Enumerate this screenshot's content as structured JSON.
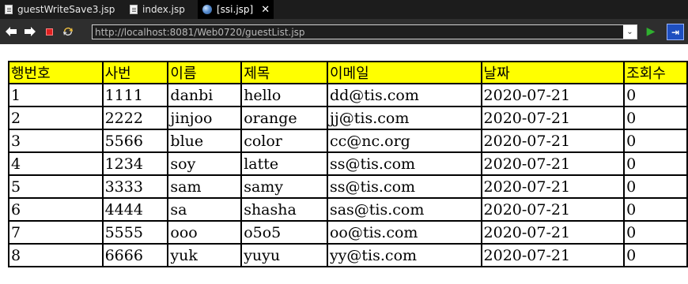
{
  "tabs": [
    {
      "label": "guestWriteSave3.jsp",
      "icon": "file-icon",
      "active": false
    },
    {
      "label": "index.jsp",
      "icon": "file-icon",
      "active": false
    },
    {
      "label": "[ssi.jsp]",
      "icon": "globe-icon",
      "active": true,
      "close": "✕"
    }
  ],
  "toolbar": {
    "back": "back-arrow-icon",
    "forward": "forward-arrow-icon",
    "stop": "stop-icon",
    "refresh": "refresh-icon",
    "url": "http://localhost:8081/Web0720/guestList.jsp",
    "dropdown": "⌄",
    "go": "go-icon",
    "external": "external-browser-icon"
  },
  "table": {
    "headers": [
      "행번호",
      "사번",
      "이름",
      "제목",
      "이메일",
      "날짜",
      "조회수"
    ],
    "rows": [
      [
        "1",
        "1111",
        "danbi",
        "hello",
        "dd@tis.com",
        "2020-07-21",
        "0"
      ],
      [
        "2",
        "2222",
        "jinjoo",
        "orange",
        "jj@tis.com",
        "2020-07-21",
        "0"
      ],
      [
        "3",
        "5566",
        "blue",
        "color",
        "cc@nc.org",
        "2020-07-21",
        "0"
      ],
      [
        "4",
        "1234",
        "soy",
        "latte",
        "ss@tis.com",
        "2020-07-21",
        "0"
      ],
      [
        "5",
        "3333",
        "sam",
        "samy",
        "ss@tis.com",
        "2020-07-21",
        "0"
      ],
      [
        "6",
        "4444",
        "sa",
        "shasha",
        "sas@tis.com",
        "2020-07-21",
        "0"
      ],
      [
        "7",
        "5555",
        "ooo",
        "o5o5",
        "oo@tis.com",
        "2020-07-21",
        "0"
      ],
      [
        "8",
        "6666",
        "yuk",
        "yuyu",
        "yy@tis.com",
        "2020-07-21",
        "0"
      ]
    ]
  },
  "colors": {
    "header_bg": "#ffff00",
    "tabbar_bg": "#1c1c1c",
    "toolbar_bg": "#2e2e2e"
  }
}
